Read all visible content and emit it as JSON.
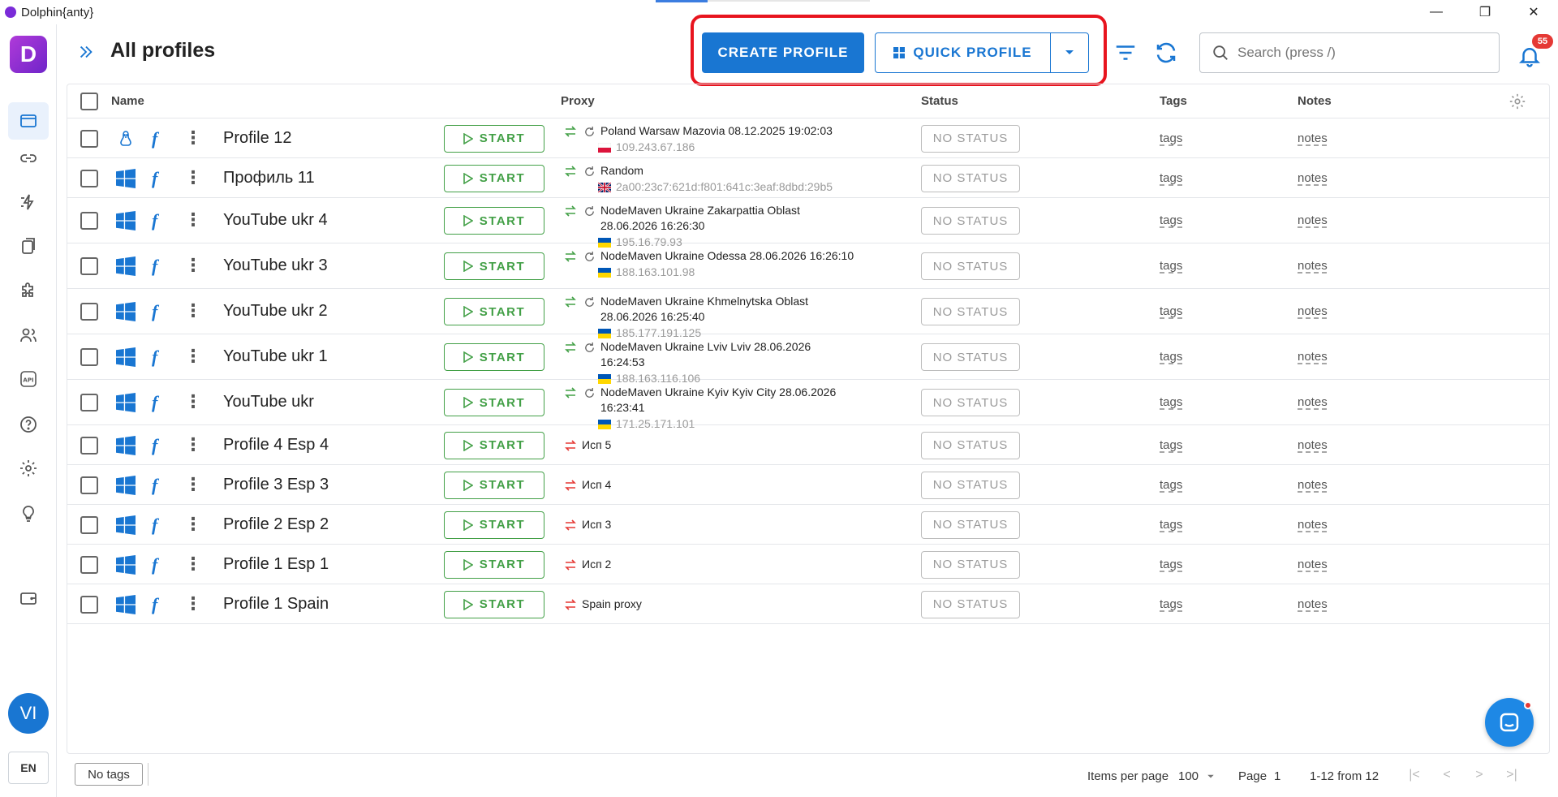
{
  "window": {
    "title": "Dolphin{anty}",
    "minimize": "—",
    "maximize": "❐",
    "close": "✕"
  },
  "sidebar": {
    "logo_letter": "D",
    "items": [
      {
        "name": "profiles-icon",
        "active": true
      },
      {
        "name": "link-icon"
      },
      {
        "name": "automation-icon"
      },
      {
        "name": "clipboard-icon"
      },
      {
        "name": "puzzle-icon"
      },
      {
        "name": "users-icon"
      },
      {
        "name": "api-icon"
      },
      {
        "name": "help-icon"
      },
      {
        "name": "settings-icon"
      },
      {
        "name": "bulb-icon"
      },
      {
        "name": "wallet-icon"
      }
    ],
    "avatar_initials": "VI",
    "language": "EN"
  },
  "header": {
    "title": "All profiles",
    "create_button": "CREATE PROFILE",
    "quick_button": "QUICK PROFILE",
    "search_placeholder": "Search (press /)",
    "notifications_count": "55"
  },
  "table": {
    "columns": {
      "name": "Name",
      "proxy": "Proxy",
      "status": "Status",
      "tags": "Tags",
      "notes": "Notes"
    },
    "start_label": "START",
    "status_label": "NO STATUS",
    "tags_label": "tags",
    "notes_label": "notes",
    "rows": [
      {
        "os": "linux",
        "name": "Profile 12",
        "proxy_type": "rotating",
        "proxy_name": "Poland Warsaw Mazovia 08.12.2025 19:02:03",
        "ip": "109.243.67.186",
        "flag": "pl"
      },
      {
        "os": "windows",
        "name": "Профиль 11",
        "proxy_type": "rotating",
        "proxy_name": "Random",
        "ip": "2a00:23c7:621d:f801:641c:3eaf:8dbd:29b5",
        "flag": "gb"
      },
      {
        "os": "windows",
        "name": "YouTube ukr 4",
        "proxy_type": "rotating",
        "proxy_name": "NodeMaven Ukraine Zakarpattia Oblast 28.06.2026 16:26:30",
        "ip": "195.16.79.93",
        "flag": "ua"
      },
      {
        "os": "windows",
        "name": "YouTube ukr 3",
        "proxy_type": "rotating",
        "proxy_name": "NodeMaven Ukraine Odessa 28.06.2026 16:26:10",
        "ip": "188.163.101.98",
        "flag": "ua"
      },
      {
        "os": "windows",
        "name": "YouTube ukr 2",
        "proxy_type": "rotating",
        "proxy_name": "NodeMaven Ukraine Khmelnytska Oblast 28.06.2026 16:25:40",
        "ip": "185.177.191.125",
        "flag": "ua"
      },
      {
        "os": "windows",
        "name": "YouTube ukr 1",
        "proxy_type": "rotating",
        "proxy_name": "NodeMaven Ukraine Lviv Lviv 28.06.2026 16:24:53",
        "ip": "188.163.116.106",
        "flag": "ua"
      },
      {
        "os": "windows",
        "name": "YouTube ukr",
        "proxy_type": "rotating",
        "proxy_name": "NodeMaven Ukraine Kyiv Kyiv City 28.06.2026 16:23:41",
        "ip": "171.25.171.101",
        "flag": "ua"
      },
      {
        "os": "windows",
        "name": "Profile 4 Esp 4",
        "proxy_type": "static",
        "proxy_name": "Исп 5",
        "ip": "",
        "flag": ""
      },
      {
        "os": "windows",
        "name": "Profile 3 Esp 3",
        "proxy_type": "static",
        "proxy_name": "Исп 4",
        "ip": "",
        "flag": ""
      },
      {
        "os": "windows",
        "name": "Profile 2 Esp 2",
        "proxy_type": "static",
        "proxy_name": "Исп 3",
        "ip": "",
        "flag": ""
      },
      {
        "os": "windows",
        "name": "Profile 1 Esp 1",
        "proxy_type": "static",
        "proxy_name": "Исп 2",
        "ip": "",
        "flag": ""
      },
      {
        "os": "windows",
        "name": "Profile 1 Spain",
        "proxy_type": "static",
        "proxy_name": "Spain proxy",
        "ip": "",
        "flag": ""
      }
    ]
  },
  "footer": {
    "no_tags": "No tags",
    "items_per_page_label": "Items per page",
    "items_per_page_value": "100",
    "page_label": "Page",
    "page_value": "1",
    "range": "1-12 from 12"
  },
  "colors": {
    "primary": "#1976d2",
    "start_green": "#43a047",
    "highlight_red": "#e8141e",
    "badge_red": "#e53935"
  }
}
